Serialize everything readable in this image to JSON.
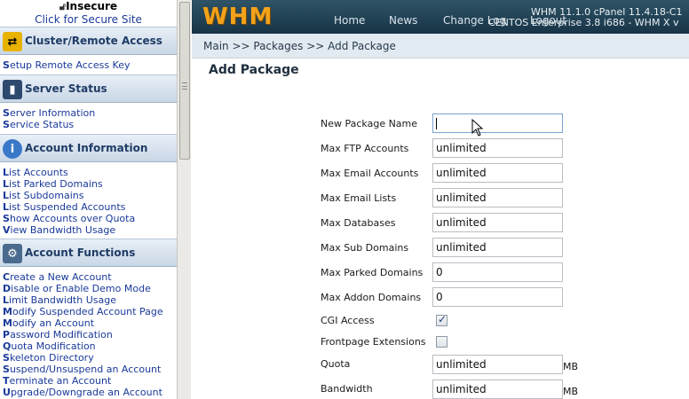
{
  "sidebar": {
    "secure": {
      "title": "Insecure",
      "link": "Click for Secure Site"
    },
    "sections": [
      {
        "title": "Cluster/Remote Access",
        "icon": "cluster-icon",
        "links": [
          "Setup Remote Access Key"
        ]
      },
      {
        "title": "Server Status",
        "icon": "server-status-icon",
        "links": [
          "Server Information",
          "Service Status"
        ]
      },
      {
        "title": "Account Information",
        "icon": "info-icon",
        "links": [
          "List Accounts",
          "List Parked Domains",
          "List Subdomains",
          "List Suspended Accounts",
          "Show Accounts over Quota",
          "View Bandwidth Usage"
        ]
      },
      {
        "title": "Account Functions",
        "icon": "account-functions-icon",
        "links": [
          "Create a New Account",
          "Disable or Enable Demo Mode",
          "Limit Bandwidth Usage",
          "Modify Suspended Account Page",
          "Modify an Account",
          "Password Modification",
          "Quota Modification",
          "Skeleton Directory",
          "Suspend/Unsuspend an Account",
          "Terminate an Account",
          "Upgrade/Downgrade an Account"
        ]
      }
    ]
  },
  "header": {
    "logo": "WHM",
    "nav": [
      "Home",
      "News",
      "Change Log",
      "Logout"
    ],
    "version_line1": "WHM 11.1.0 cPanel 11.4.18-C1",
    "version_line2": "CENTOS Enterprise 3.8 i686 - WHM X v"
  },
  "breadcrumb": "Main >> Packages >> Add Package",
  "page_title": "Add Package",
  "form": {
    "fields": [
      {
        "label": "New Package Name",
        "value": "",
        "type": "text"
      },
      {
        "label": "Max FTP Accounts",
        "value": "unlimited",
        "type": "text"
      },
      {
        "label": "Max Email Accounts",
        "value": "unlimited",
        "type": "text"
      },
      {
        "label": "Max Email Lists",
        "value": "unlimited",
        "type": "text"
      },
      {
        "label": "Max Databases",
        "value": "unlimited",
        "type": "text"
      },
      {
        "label": "Max Sub Domains",
        "value": "unlimited",
        "type": "text"
      },
      {
        "label": "Max Parked Domains",
        "value": "0",
        "type": "text"
      },
      {
        "label": "Max Addon Domains",
        "value": "0",
        "type": "text"
      },
      {
        "label": "CGI Access",
        "checked": true,
        "type": "checkbox"
      },
      {
        "label": "Frontpage Extensions",
        "checked": false,
        "type": "checkbox"
      },
      {
        "label": "Quota",
        "value": "unlimited",
        "unit": "MB",
        "type": "text"
      },
      {
        "label": "Bandwidth",
        "value": "unlimited",
        "unit": "MB",
        "type": "text"
      }
    ]
  },
  "colors": {
    "accent": "#f2a21a",
    "topbar": "#1f3f52",
    "link": "#1a3a9a"
  }
}
